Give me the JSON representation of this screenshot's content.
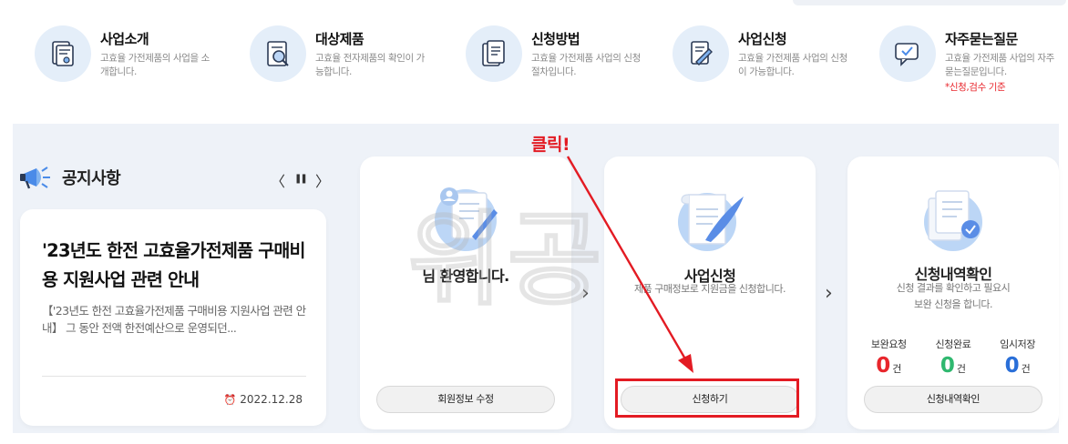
{
  "nav": {
    "items": [
      {
        "title": "사업소개",
        "desc": "고효율 가전제품의 사업을 소개합니다.",
        "icon": "document-certificate-icon"
      },
      {
        "title": "대상제품",
        "desc": "고효율 전자제품의 확인이 가능합니다.",
        "icon": "search-document-icon"
      },
      {
        "title": "신청방법",
        "desc": "고효율 가전제품 사업의 신청절차입니다.",
        "icon": "document-list-icon"
      },
      {
        "title": "사업신청",
        "desc": "고효율 가전제품 사업의 신청이 가능합니다.",
        "icon": "signing-hand-icon"
      },
      {
        "title": "자주묻는질문",
        "desc": "고효율 가전제품 사업의 자주묻는질문입니다.",
        "note": "*신청,검수 기준",
        "icon": "chat-check-icon"
      }
    ]
  },
  "notice": {
    "title": "공지사항",
    "headline": "'23년도 한전 고효율가전제품 구매비용 지원사업 관련 안내",
    "summary": "【'23년도 한전 고효율가전제품 구매비용 지원사업 관련 안내】 그 동안 전액 한전예산으로 운영되던...",
    "date": "2022.12.28",
    "controls": {
      "prev": "〈",
      "pause": "❚❚",
      "next": "〉"
    }
  },
  "cards": {
    "welcome": {
      "title": "님 환영합니다.",
      "button": "회원정보 수정"
    },
    "apply": {
      "title": "사업신청",
      "desc": "제품 구매정보로 지원금을 신청합니다.",
      "button": "신청하기"
    },
    "history": {
      "title": "신청내역확인",
      "desc_line1": "신청 결과를 확인하고 필요시",
      "desc_line2": "보완 신청을 합니다.",
      "button": "신청내역확인",
      "stats": [
        {
          "label": "보완요청",
          "value": "0",
          "unit": "건",
          "color": "#e8262c"
        },
        {
          "label": "신청완료",
          "value": "0",
          "unit": "건",
          "color": "#2fb86f"
        },
        {
          "label": "임시저장",
          "value": "0",
          "unit": "건",
          "color": "#2a6fd8"
        }
      ]
    }
  },
  "annotation": {
    "click_label": "클릭!",
    "watermark": "위공",
    "color": "#e31b23"
  },
  "colors": {
    "panel_bg": "#eef2f8",
    "icon_bg": "#e4eef9",
    "accent_blue": "#4a8be8"
  }
}
